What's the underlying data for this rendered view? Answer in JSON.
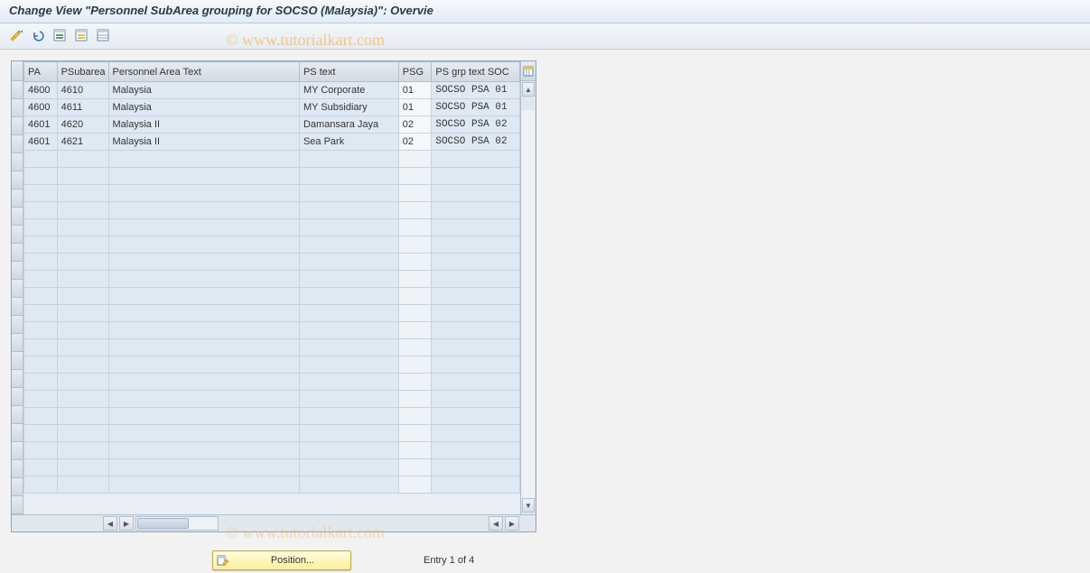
{
  "title": "Change View \"Personnel SubArea grouping for SOCSO (Malaysia)\": Overvie",
  "watermark": "© www.tutorialkart.com",
  "columns": {
    "pa": "PA",
    "psubarea": "PSubarea",
    "patext": "Personnel Area Text",
    "pstext": "PS text",
    "psg": "PSG",
    "psgrptext": "PS grp text SOC"
  },
  "rows": [
    {
      "pa": "4600",
      "psubarea": "4610",
      "patext": "Malaysia",
      "pstext": "MY Corporate",
      "psg": "01",
      "psgrptext": "SOCSO PSA 01"
    },
    {
      "pa": "4600",
      "psubarea": "4611",
      "patext": "Malaysia",
      "pstext": "MY Subsidiary",
      "psg": "01",
      "psgrptext": "SOCSO PSA 01"
    },
    {
      "pa": "4601",
      "psubarea": "4620",
      "patext": "Malaysia II",
      "pstext": "Damansara Jaya",
      "psg": "02",
      "psgrptext": "SOCSO PSA 02"
    },
    {
      "pa": "4601",
      "psubarea": "4621",
      "patext": "Malaysia II",
      "pstext": "Sea Park",
      "psg": "02",
      "psgrptext": "SOCSO PSA 02"
    }
  ],
  "empty_row_count": 20,
  "footer": {
    "position_label": "Position...",
    "entry_text": "Entry 1 of 4"
  }
}
